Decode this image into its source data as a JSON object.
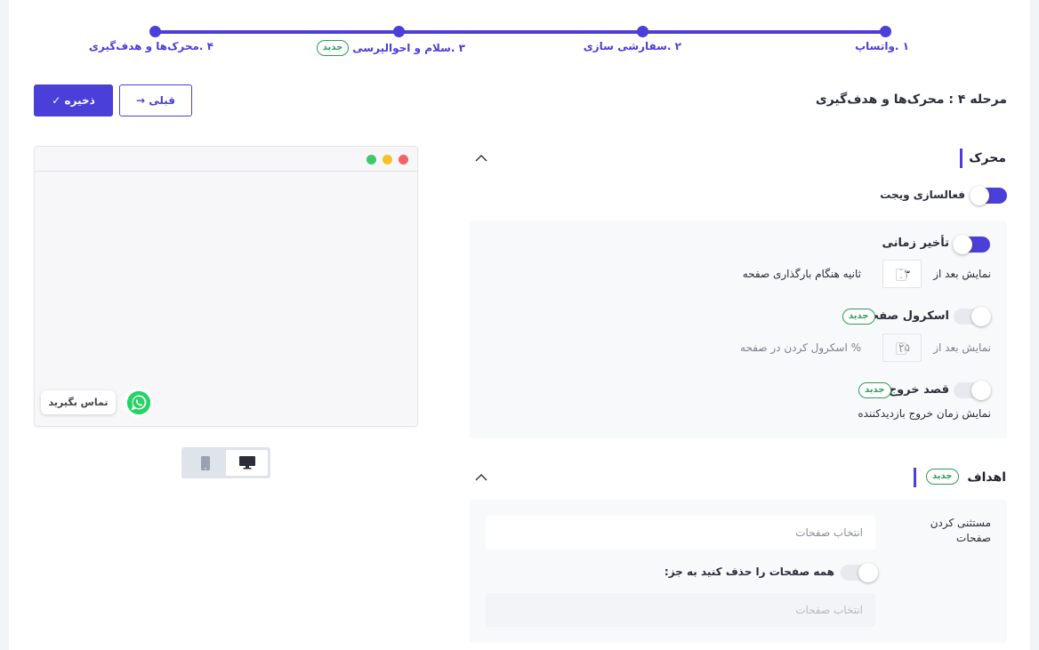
{
  "stepper": {
    "steps": [
      {
        "label": "۱ .واتساپ"
      },
      {
        "label": "۲ .سفارشی سازی"
      },
      {
        "label": "۳ .سلام و احوالپرسی",
        "badge": "جدید"
      },
      {
        "label": "۴ .محرک‌ها و هدف‌گیری"
      }
    ]
  },
  "page": {
    "title": "مرحله ۴ : محرک‌ها و هدف‌گیری"
  },
  "toolbar": {
    "save_label": "✓ ذخیره",
    "prev_label": "→ قبلی"
  },
  "preview": {
    "chat_label": "تماس بگیرید",
    "dots": [
      "#f26464",
      "#f5c124",
      "#3ec86b"
    ],
    "device_active": "desktop"
  },
  "trigger": {
    "heading": "محرک",
    "widget_toggle_label": "فعالسازی ویجت",
    "widget_on": true,
    "time_delay": {
      "label": "تأخیر زمانی",
      "on": true,
      "prefix": "نمایش بعد از",
      "value": "۳",
      "suffix": "ثانیه هنگام بارگذاری صفحه"
    },
    "scroll": {
      "label": "اسکرول صفحه",
      "badge": "جدید",
      "on": false,
      "prefix": "نمایش بعد از",
      "value": "۲۵",
      "suffix": "% اسکرول کردن در صفحه"
    },
    "exit_intent": {
      "label": "قصد خروج",
      "badge": "جدید",
      "on": false,
      "description": "نمایش زمان خروج بازدیدکننده"
    }
  },
  "targeting": {
    "heading": "اهداف",
    "badge": "جدید",
    "exclude_label_line1": "مستثنی کردن",
    "exclude_label_line2": "صفحات",
    "exclude_placeholder": "انتخاب صفحات",
    "remove_all_label": "همه صفحات را حذف کنید به جز:",
    "remove_all_on": false,
    "except_placeholder": "انتخاب صفحات"
  },
  "colors": {
    "accent": "#4b3fd9",
    "badge_green": "#2e9c5a",
    "whatsapp": "#25d366"
  }
}
